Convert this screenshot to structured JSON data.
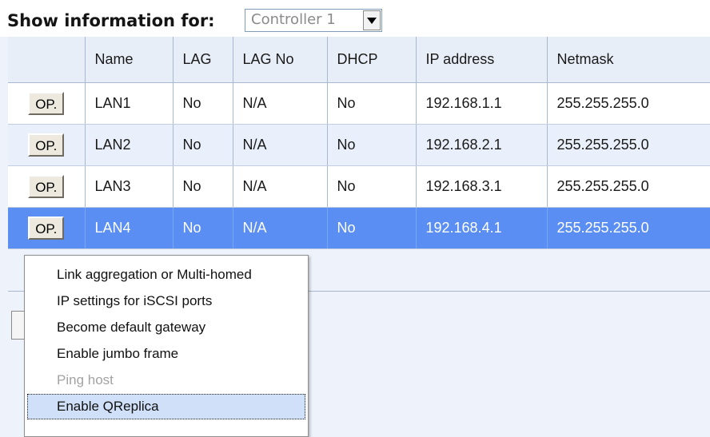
{
  "header": {
    "show_label": "Show information for:",
    "controller_select": {
      "selected": "Controller 1"
    }
  },
  "table": {
    "columns": [
      "",
      "Name",
      "LAG",
      "LAG No",
      "DHCP",
      "IP address",
      "Netmask"
    ],
    "rows": [
      {
        "op": "OP.",
        "name": "LAN1",
        "lag": "No",
        "lag_no": "N/A",
        "dhcp": "No",
        "ip": "192.168.1.1",
        "netmask": "255.255.255.0",
        "selected": false
      },
      {
        "op": "OP.",
        "name": "LAN2",
        "lag": "No",
        "lag_no": "N/A",
        "dhcp": "No",
        "ip": "192.168.2.1",
        "netmask": "255.255.255.0",
        "selected": false
      },
      {
        "op": "OP.",
        "name": "LAN3",
        "lag": "No",
        "lag_no": "N/A",
        "dhcp": "No",
        "ip": "192.168.3.1",
        "netmask": "255.255.255.0",
        "selected": false
      },
      {
        "op": "OP.",
        "name": "LAN4",
        "lag": "No",
        "lag_no": "N/A",
        "dhcp": "No",
        "ip": "192.168.4.1",
        "netmask": "255.255.255.0",
        "selected": true
      }
    ]
  },
  "context_menu": {
    "items": [
      {
        "label": "Link aggregation or Multi-homed",
        "enabled": true
      },
      {
        "label": "IP settings for iSCSI ports",
        "enabled": true
      },
      {
        "label": "Become default gateway",
        "enabled": true
      },
      {
        "label": "Enable jumbo frame",
        "enabled": true
      },
      {
        "label": "Ping host",
        "enabled": false
      },
      {
        "label": "Enable QReplica",
        "enabled": true,
        "hovered": true
      }
    ]
  },
  "colors": {
    "selected_row": "#5a8ef2",
    "header_bg": "#e8eef8",
    "menu_hover": "#cfe0f8",
    "disabled_text": "#a2a2a2"
  },
  "icons": {
    "select_arrow": "chevron-down-icon"
  }
}
